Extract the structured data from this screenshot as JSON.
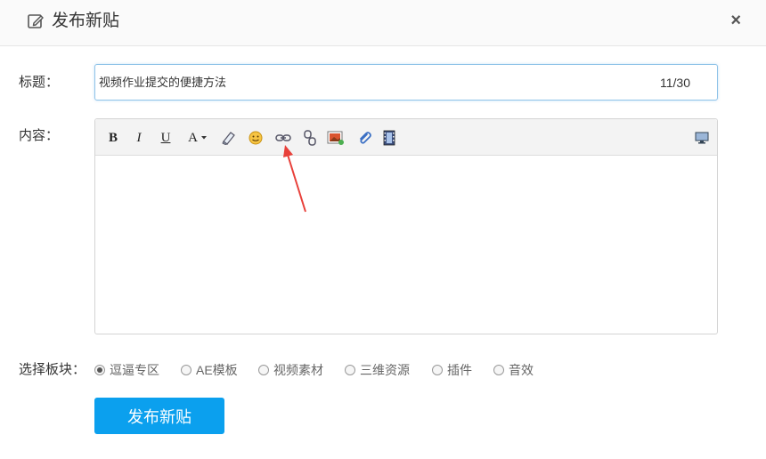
{
  "dialog": {
    "title": "发布新贴",
    "close_symbol": "×"
  },
  "form": {
    "title_label": "标题：",
    "title_value": "视频作业提交的便捷方法",
    "title_count": "11/30",
    "content_label": "内容：",
    "board_label": "选择板块：",
    "submit_label": "发布新贴"
  },
  "toolbar": {
    "bold": "B",
    "italic": "I",
    "underline": "U",
    "font_color": "A",
    "icons": [
      "bold-icon",
      "italic-icon",
      "underline-icon",
      "font-color-icon",
      "eraser-icon",
      "emoji-icon",
      "link-icon",
      "unlink-icon",
      "image-icon",
      "attachment-icon",
      "video-icon",
      "fullscreen-icon"
    ]
  },
  "boards": [
    {
      "label": "逗逼专区",
      "checked": true
    },
    {
      "label": "AE模板",
      "checked": false
    },
    {
      "label": "视频素材",
      "checked": false
    },
    {
      "label": "三维资源",
      "checked": false
    },
    {
      "label": "插件",
      "checked": false
    },
    {
      "label": "音效",
      "checked": false
    }
  ],
  "colors": {
    "accent": "#0ba0ee",
    "annotation_arrow": "#e8403a"
  }
}
